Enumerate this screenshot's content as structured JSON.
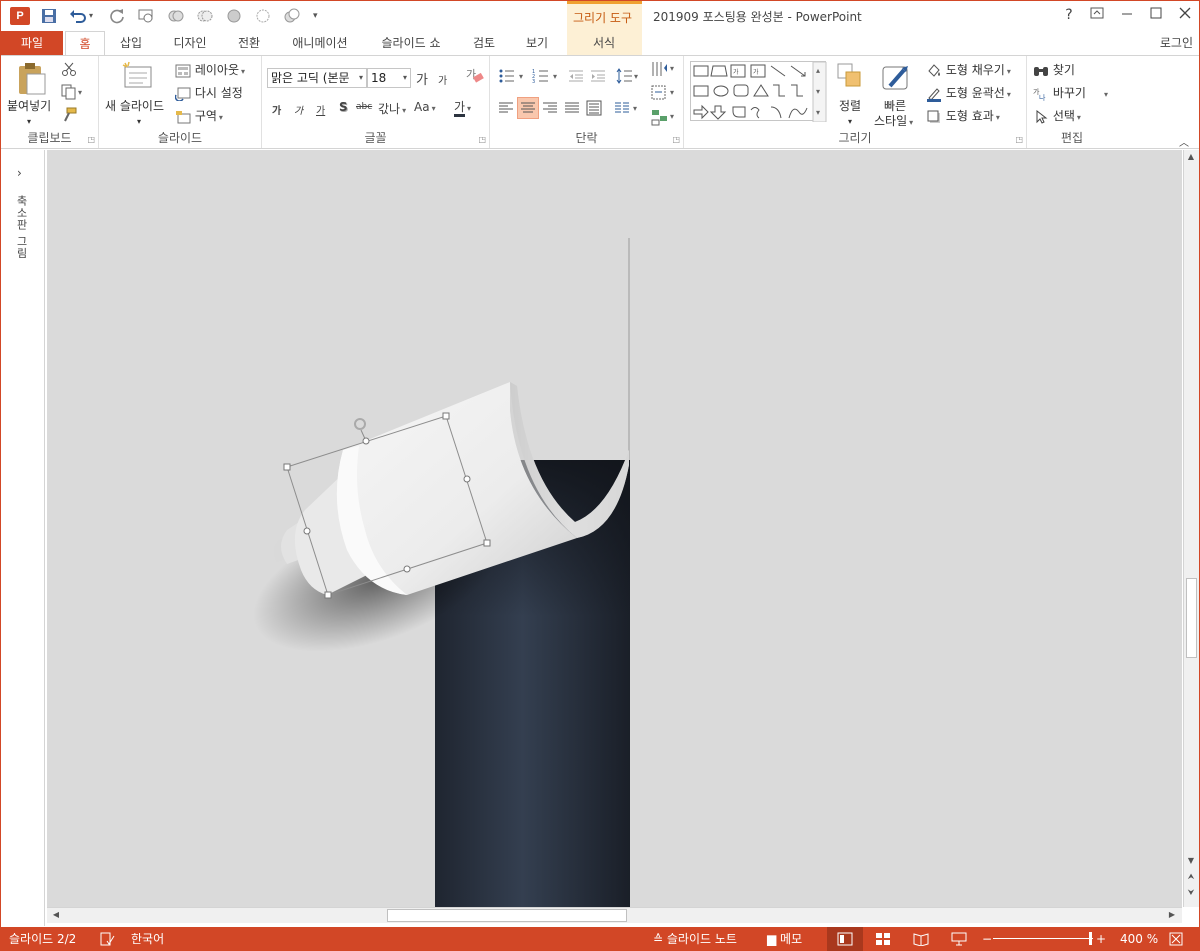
{
  "app": {
    "icon_label": "P",
    "window_title": "201909 포스팅용 완성본 - PowerPoint",
    "context_tool_title": "그리기 도구",
    "help": "?",
    "login": "로그인"
  },
  "qat": {
    "save": "save-icon",
    "undo": "undo-icon",
    "redo": "redo-icon",
    "customize": "▾"
  },
  "tabs": [
    {
      "label": "파일"
    },
    {
      "label": "홈"
    },
    {
      "label": "삽입"
    },
    {
      "label": "디자인"
    },
    {
      "label": "전환"
    },
    {
      "label": "애니메이션"
    },
    {
      "label": "슬라이드 쇼"
    },
    {
      "label": "검토"
    },
    {
      "label": "보기"
    },
    {
      "label": "서식"
    }
  ],
  "ribbon": {
    "clipboard": {
      "group": "클립보드",
      "paste": "붙여넣기"
    },
    "slides": {
      "group": "슬라이드",
      "new_slide": "새 슬라이드",
      "layout": "레이아웃",
      "reset": "다시 설정",
      "section": "구역"
    },
    "font": {
      "group": "글꼴",
      "font_name": "맑은 고딕 (본문",
      "font_size": "18",
      "grow": "가",
      "shrink": "가",
      "clear": "가",
      "bold": "가",
      "italic": "가",
      "underline": "가",
      "shadow": "S",
      "strike": "abc",
      "spacing": "갃나",
      "case": "Aa",
      "color": "가"
    },
    "paragraph": {
      "group": "단락"
    },
    "drawing": {
      "group": "그리기",
      "arrange": "정렬",
      "quick_styles_1": "빠른",
      "quick_styles_2": "스타일",
      "fill": "도형 채우기",
      "outline": "도형 윤곽선",
      "effects": "도형 효과"
    },
    "editing": {
      "group": "편집",
      "find": "찾기",
      "replace": "바꾸기",
      "select": "선택"
    }
  },
  "left_pane": {
    "label": "축소판 그림",
    "expand": "›"
  },
  "status": {
    "slide": "슬라이드 2/2",
    "language": "한국어",
    "notes": "슬라이드 노트",
    "comments": "메모",
    "zoom": "400 %"
  },
  "colors": {
    "accent": "#d24726",
    "context": "#c55a11",
    "canvas": "#dadada",
    "paper_dark": "#2c3440"
  }
}
